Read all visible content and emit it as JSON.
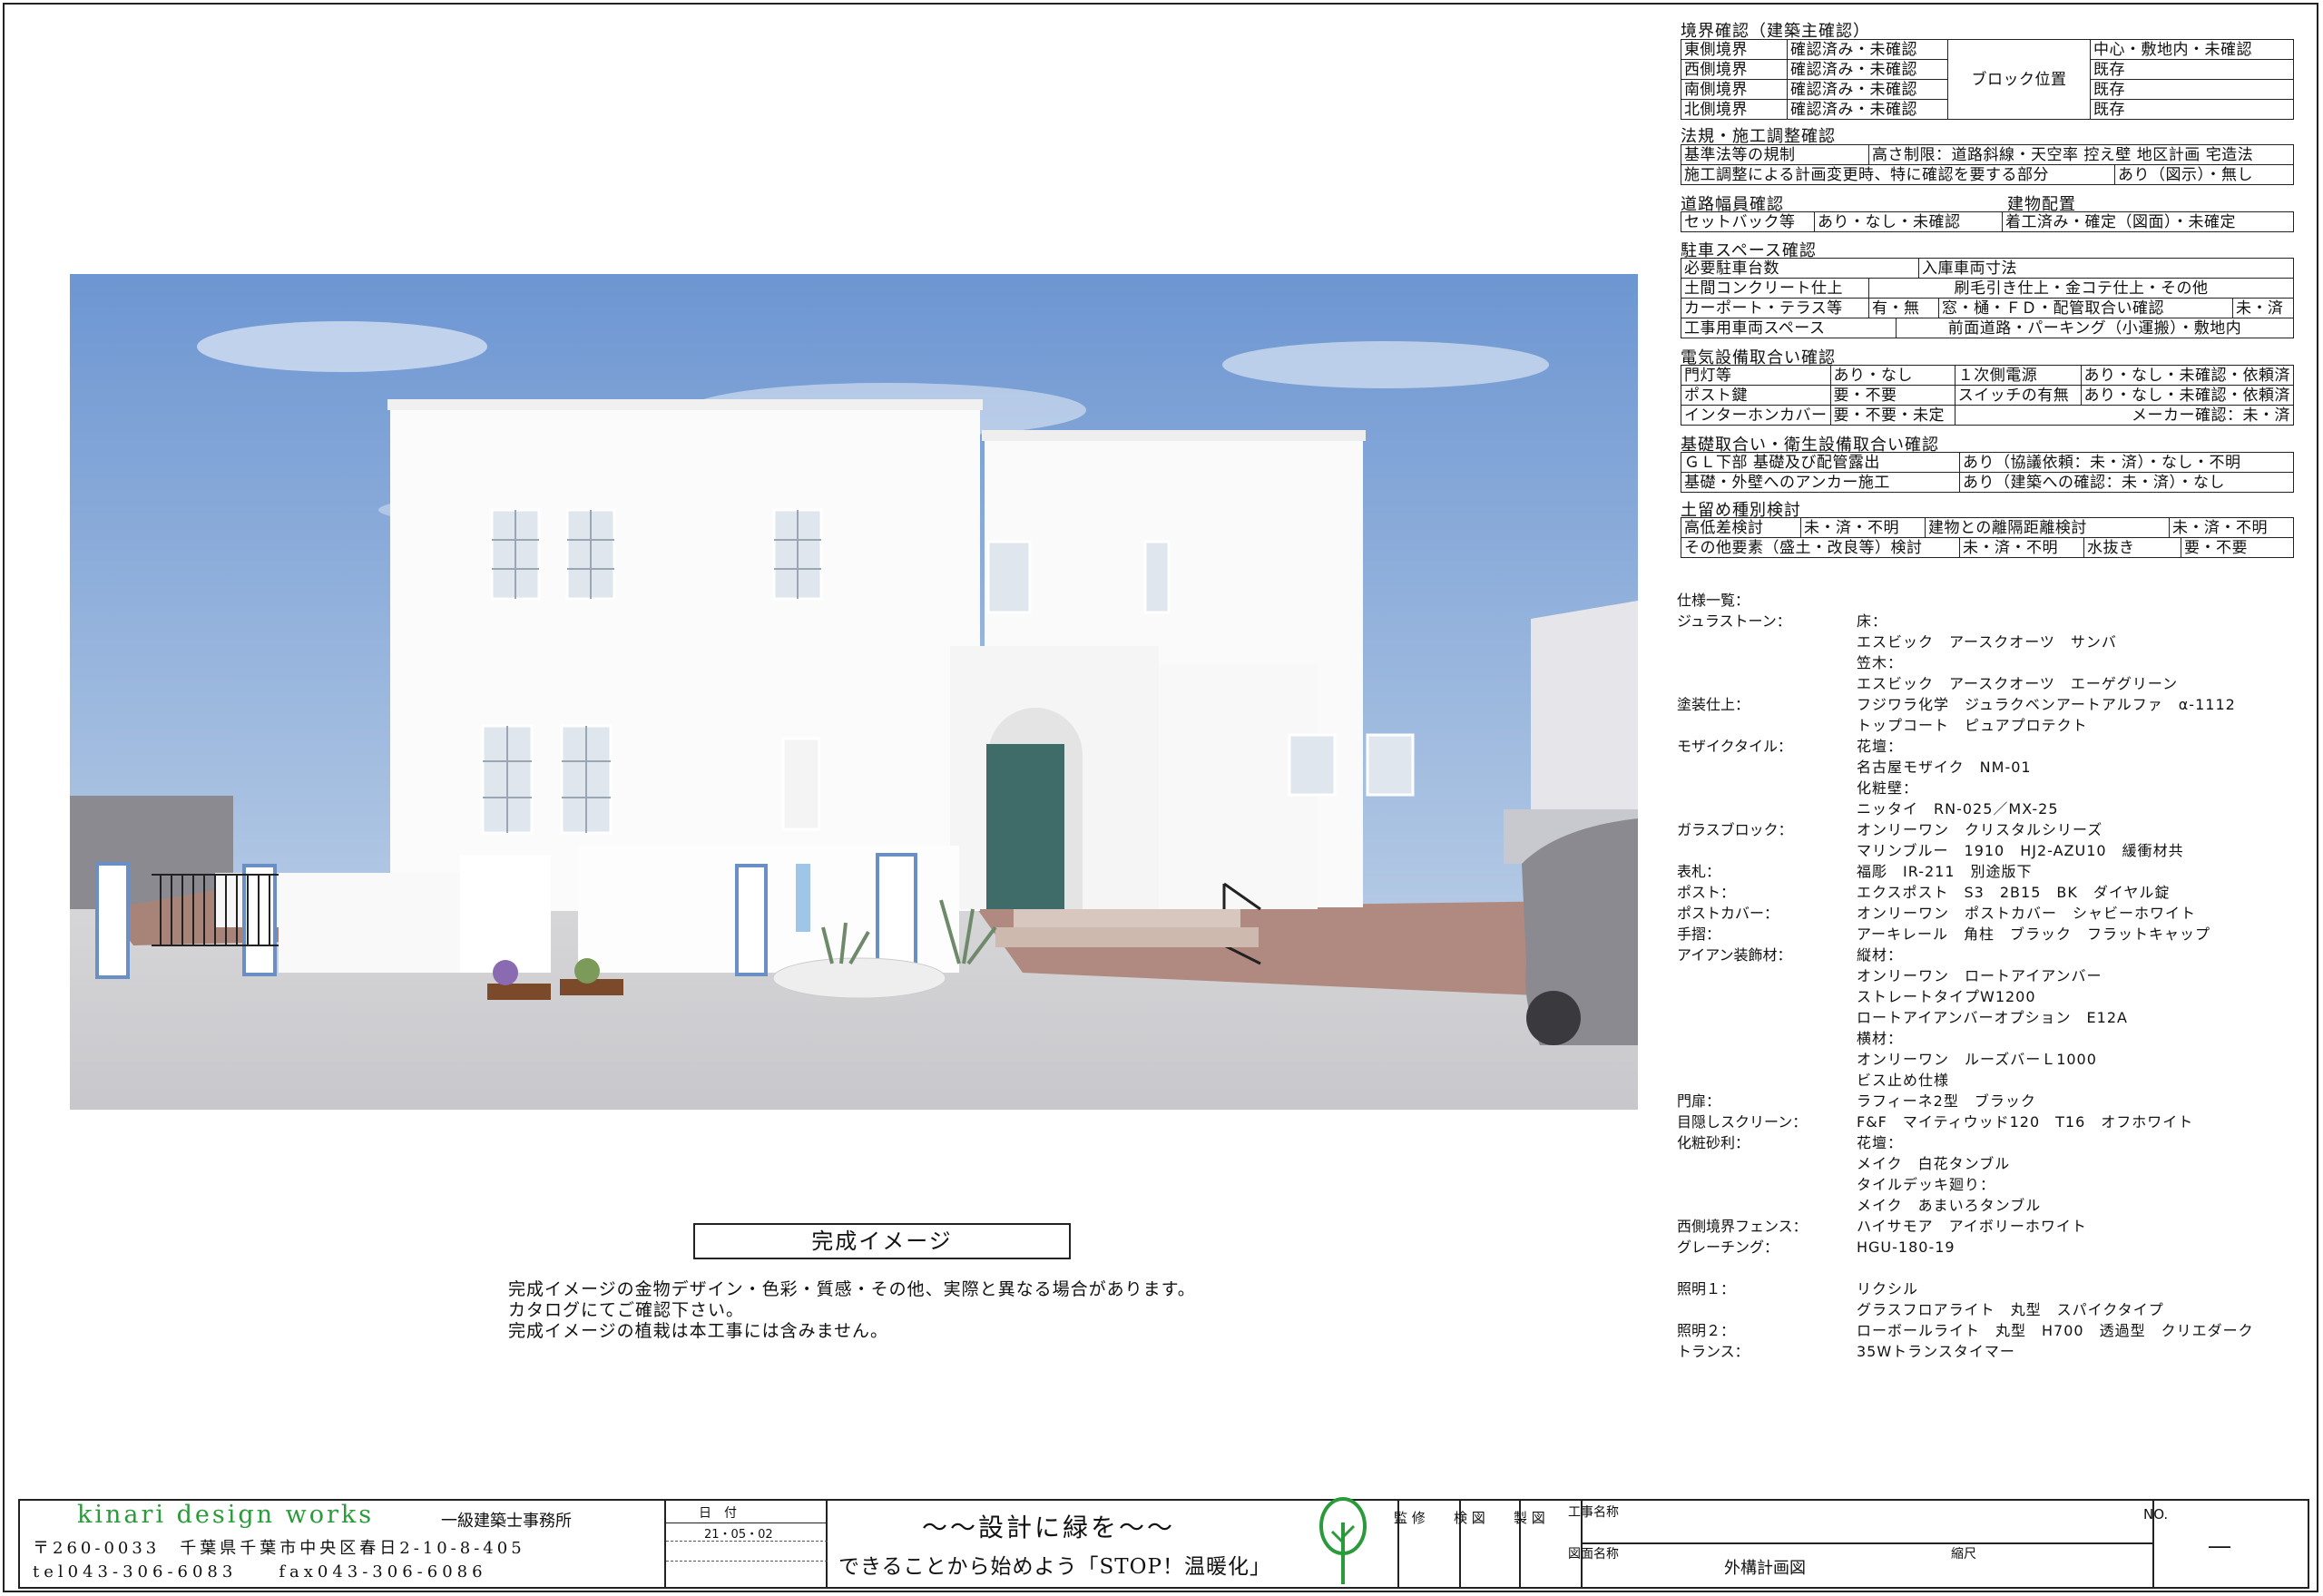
{
  "boundary": {
    "title": "境界確認（建築主確認）",
    "rows": [
      {
        "side": "東側境界",
        "status": "確認済み・未確認",
        "pos": "中心・敷地内・未確認"
      },
      {
        "side": "西側境界",
        "status": "確認済み・未確認",
        "pos": "既存"
      },
      {
        "side": "南側境界",
        "status": "確認済み・未確認",
        "pos": "既存"
      },
      {
        "side": "北側境界",
        "status": "確認済み・未確認",
        "pos": "既存"
      }
    ],
    "block_label": "ブロック位置"
  },
  "law": {
    "title": "法規・施工調整確認",
    "row1_label": "基準法等の規制",
    "row1_value": "高さ制限：道路斜線・天空率  控え壁  地区計画  宅造法",
    "row2_label": "施工調整による計画変更時、特に確認を要する部分",
    "row2_value": "あり（図示）・無し"
  },
  "road": {
    "title": "道路幅員確認",
    "title2": "建物配置",
    "setback_label": "セットバック等",
    "setback_value": "あり・なし・未確認",
    "placement_value": "着工済み・確定（図面）・未確定"
  },
  "parking": {
    "title": "駐車スペース確認",
    "rows": [
      [
        "必要駐車台数",
        "入庫車両寸法"
      ],
      [
        "土間コンクリート仕上",
        "刷毛引き仕上・金コテ仕上・その他"
      ],
      [
        "カーポート・テラス等",
        "有・無",
        "窓・樋・ＦＤ・配管取合い確認",
        "未・済"
      ],
      [
        "工事用車両スペース",
        "前面道路・パーキング（小運搬）・敷地内"
      ]
    ]
  },
  "electric": {
    "title": "電気設備取合い確認",
    "rows": [
      [
        "門灯等",
        "あり・なし",
        "１次側電源",
        "あり・なし・未確認・依頼済"
      ],
      [
        "ポスト鍵",
        "要・不要",
        "スイッチの有無",
        "あり・なし・未確認・依頼済"
      ],
      [
        "インターホンカバー",
        "要・不要・未定",
        "メーカー確認：未・済"
      ]
    ]
  },
  "foundation": {
    "title": "基礎取合い・衛生設備取合い確認",
    "rows": [
      [
        "ＧＬ下部  基礎及び配管露出",
        "あり（協議依頼：未・済）・なし・不明"
      ],
      [
        "基礎・外壁へのアンカー施工",
        "あり（建築への確認：未・済）・なし"
      ]
    ]
  },
  "soil": {
    "title": "土留め種別検討",
    "rows": [
      [
        "高低差検討",
        "未・済・不明",
        "建物との離隔距離検討",
        "未・済・不明"
      ],
      [
        "その他要素（盛土・改良等）検討",
        "未・済・不明",
        "水抜き",
        "要・不要"
      ]
    ]
  },
  "spec": {
    "title": "仕様一覧：",
    "rows": [
      [
        "ジュラストーン：",
        "床："
      ],
      [
        "",
        "エスビック　アースクオーツ　サンバ"
      ],
      [
        "",
        "笠木："
      ],
      [
        "",
        "エスビック　アースクオーツ　エーゲグリーン"
      ],
      [
        "塗装仕上：",
        "フジワラ化学　ジュラクベンアートアルファ　α-1112"
      ],
      [
        "",
        "トップコート　ピュアプロテクト"
      ],
      [
        "モザイクタイル：",
        "花壇："
      ],
      [
        "",
        "名古屋モザイク　NM-01"
      ],
      [
        "",
        "化粧壁："
      ],
      [
        "",
        "ニッタイ　RN-025／MX-25"
      ],
      [
        "ガラスブロック：",
        "オンリーワン　クリスタルシリーズ"
      ],
      [
        "",
        "マリンブルー　1910　HJ2-AZU10　緩衝材共"
      ],
      [
        "表札：",
        "福彫　IR-211　別途版下"
      ],
      [
        "ポスト：",
        "エクスポスト　S3　2B15　BK　ダイヤル錠"
      ],
      [
        "ポストカバー：",
        "オンリーワン　ポストカバー　シャビーホワイト"
      ],
      [
        "手摺：",
        "アーキレール　角柱　ブラック　フラットキャップ"
      ],
      [
        "アイアン装飾材：",
        "縦材："
      ],
      [
        "",
        "オンリーワン　ロートアイアンバー"
      ],
      [
        "",
        "ストレートタイプW1200"
      ],
      [
        "",
        "ロートアイアンバーオプション　E12A"
      ],
      [
        "",
        "横材："
      ],
      [
        "",
        "オンリーワン　ルーズバーＬ1000"
      ],
      [
        "",
        "ビス止め仕様"
      ],
      [
        "門扉：",
        "ラフィーネ2型　ブラック"
      ],
      [
        "目隠しスクリーン：",
        "F&F　マイティウッド120　T16　オフホワイト"
      ],
      [
        "化粧砂利：",
        "花壇："
      ],
      [
        "",
        "メイク　白花タンブル"
      ],
      [
        "",
        "タイルデッキ廻り："
      ],
      [
        "",
        "メイク　あまいろタンブル"
      ],
      [
        "西側境界フェンス：",
        "ハイサモア　アイボリーホワイト"
      ],
      [
        "グレーチング：",
        "HGU-180-19"
      ],
      [
        "",
        ""
      ],
      [
        "照明１：",
        "リクシル"
      ],
      [
        "",
        "グラスフロアライト　丸型　スパイクタイプ"
      ],
      [
        "照明２：",
        "ローボールライト　丸型　H700　透過型　クリエダーク"
      ],
      [
        "トランス：",
        "35Wトランスタイマー"
      ]
    ]
  },
  "caption": "完成イメージ",
  "notes": [
    "完成イメージの金物デザイン・色彩・質感・その他、実際と異なる場合があります。",
    "カタログにてご確認下さい。",
    "完成イメージの植栽は本工事には含みません。"
  ],
  "titleblock": {
    "brand": "kinari design works",
    "office": "一級建築士事務所",
    "address": "〒260-0033　千葉県千葉市中央区春日2-10-8-405",
    "tel": "tel043-306-6083　　fax043-306-6086",
    "date_label": "日　付",
    "date": "21・05・02",
    "slogan1": "～～設計に緑を～～",
    "slogan2": "できることから始めよう「STOP！温暖化」",
    "supervise": "監 修",
    "check": "検 図",
    "draw": "製 図",
    "project_label": "工事名称",
    "drawing_label": "図面名称",
    "drawing_name": "外構計画図",
    "scale_label": "縮尺",
    "no_label": "NO.",
    "no_value": "―"
  },
  "colors": {
    "brand": "#2a9a3a",
    "sky": "#7fa6d8",
    "door": "#3f6b68",
    "paving": "#b08a80"
  }
}
